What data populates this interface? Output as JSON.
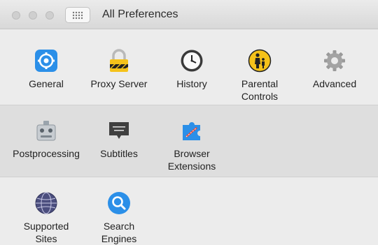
{
  "window": {
    "title": "All Preferences"
  },
  "sections": [
    {
      "items": [
        {
          "label": "General",
          "icon": "general-gear-icon"
        },
        {
          "label": "Proxy Server",
          "icon": "proxy-lock-icon"
        },
        {
          "label": "History",
          "icon": "clock-icon"
        },
        {
          "label": "Parental\nControls",
          "icon": "parental-controls-icon"
        },
        {
          "label": "Advanced",
          "icon": "advanced-gear-icon"
        }
      ]
    },
    {
      "items": [
        {
          "label": "Postprocessing",
          "icon": "postprocessing-icon"
        },
        {
          "label": "Subtitles",
          "icon": "subtitles-icon"
        },
        {
          "label": "Browser\nExtensions",
          "icon": "puzzle-piece-icon"
        }
      ]
    },
    {
      "items": [
        {
          "label": "Supported\nSites",
          "icon": "globe-icon"
        },
        {
          "label": "Search\nEngines",
          "icon": "magnifier-icon"
        }
      ]
    }
  ],
  "colors": {
    "accent_blue": "#2b8fe8",
    "warning_yellow": "#f5c21a"
  }
}
